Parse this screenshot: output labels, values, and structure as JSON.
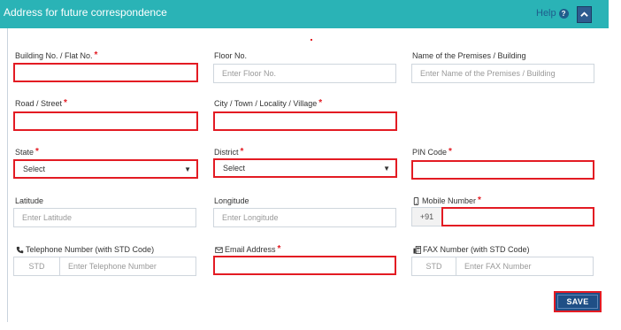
{
  "header": {
    "title": "Address for future correspondence",
    "help_label": "Help",
    "help_icon": "question-circle-icon",
    "collapse_icon": "chevron-up-icon"
  },
  "fields": {
    "building": {
      "label": "Building No. / Flat No.",
      "required": "*",
      "value": ""
    },
    "floor": {
      "label": "Floor No.",
      "placeholder": "Enter Floor No."
    },
    "premises": {
      "label": "Name of the Premises / Building",
      "placeholder": "Enter Name of the Premises / Building"
    },
    "road": {
      "label": "Road / Street",
      "required": "*",
      "value": ""
    },
    "city": {
      "label": "City / Town / Locality / Village",
      "required": "*",
      "value": ""
    },
    "state": {
      "label": "State",
      "required": "*",
      "selected": "Select"
    },
    "district": {
      "label": "District",
      "required": "*",
      "selected": "Select"
    },
    "pin": {
      "label": "PIN Code",
      "required": "*",
      "value": ""
    },
    "latitude": {
      "label": "Latitude",
      "placeholder": "Enter Latitude"
    },
    "longitude": {
      "label": "Longitude",
      "placeholder": "Enter Longitude"
    },
    "mobile": {
      "label": "Mobile Number",
      "required": "*",
      "prefix": "+91",
      "icon": "mobile-phone-icon"
    },
    "telephone": {
      "label": "Telephone Number (with STD Code)",
      "std": "STD",
      "placeholder": "Enter Telephone Number",
      "icon": "phone-icon"
    },
    "email": {
      "label": "Email Address",
      "required": "*",
      "value": "",
      "icon": "envelope-icon"
    },
    "fax": {
      "label": "FAX Number (with STD Code)",
      "std": "STD",
      "placeholder": "Enter FAX Number",
      "icon": "fax-icon"
    }
  },
  "actions": {
    "save_label": "SAVE"
  },
  "colors": {
    "header_bg": "#2ab3b6",
    "error_border": "#e31b23",
    "primary_button": "#1f4f86"
  }
}
